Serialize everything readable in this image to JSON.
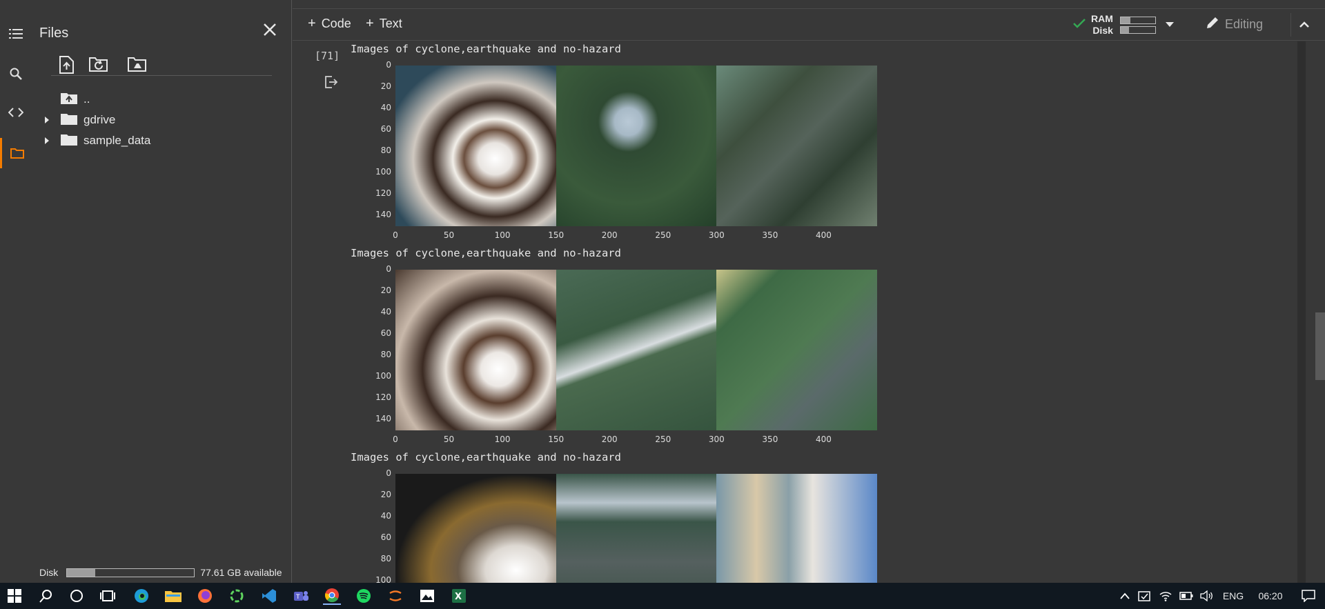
{
  "sidebar": {
    "panel_title": "Files",
    "tree": [
      {
        "label": ".."
      },
      {
        "label": "gdrive"
      },
      {
        "label": "sample_data"
      }
    ],
    "disk_label": "Disk",
    "disk_available": "77.61 GB available",
    "disk_used_fraction": 0.22
  },
  "toolbar": {
    "code_label": "Code",
    "text_label": "Text",
    "ram_label": "RAM",
    "disk_label": "Disk",
    "ram_used_fraction": 0.28,
    "disk_used_fraction": 0.25,
    "editing_label": "Editing"
  },
  "cell": {
    "execution_count": "[71]",
    "outputs": [
      {
        "text": "Images of cyclone,earthquake and no-hazard"
      },
      {
        "text": "Images of cyclone,earthquake and no-hazard"
      },
      {
        "text": "Images of cyclone,earthquake and no-hazard"
      }
    ],
    "y_ticks": [
      "0",
      "20",
      "40",
      "60",
      "80",
      "100",
      "120",
      "140"
    ],
    "x_ticks": [
      "0",
      "50",
      "100",
      "150",
      "200",
      "250",
      "300",
      "350",
      "400"
    ]
  },
  "taskbar": {
    "language": "ENG",
    "time": "06:20"
  },
  "colors": {
    "accent": "#f57c00",
    "check": "#34a853",
    "background": "#383838"
  }
}
